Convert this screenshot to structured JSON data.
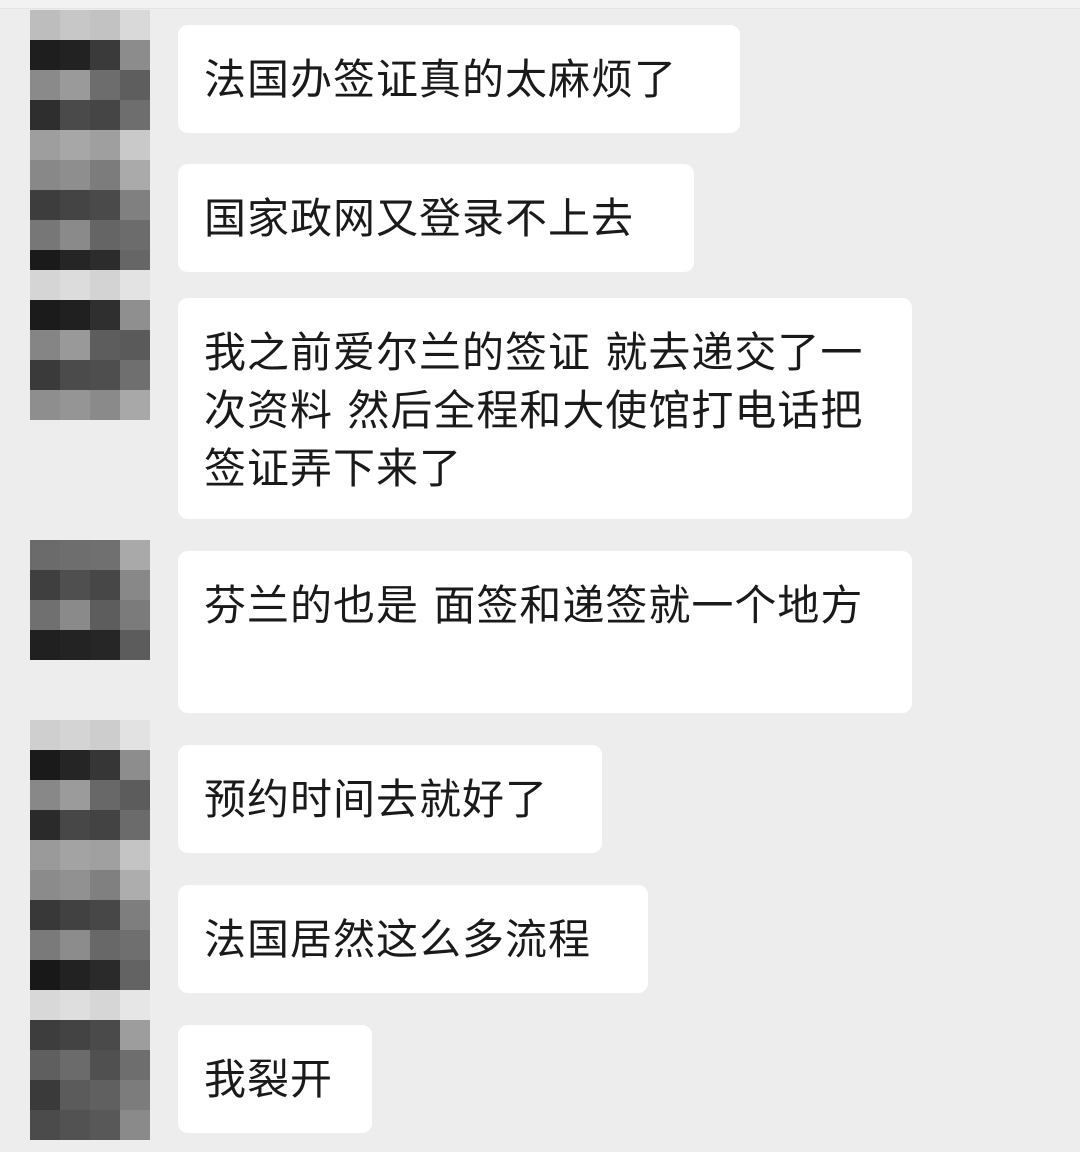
{
  "chat": {
    "messages": [
      {
        "text": "法国办签证真的太麻烦了"
      },
      {
        "text": "国家政网又登录不上去"
      },
      {
        "text": "我之前爱尔兰的签证 就去递交了一次资料 然后全程和大使馆打电话把签证弄下来了"
      },
      {
        "text": "芬兰的也是 面签和递签就一个地方"
      },
      {
        "text": "预约时间去就好了"
      },
      {
        "text": "法国居然这么多流程"
      },
      {
        "text": "我裂开"
      }
    ]
  }
}
